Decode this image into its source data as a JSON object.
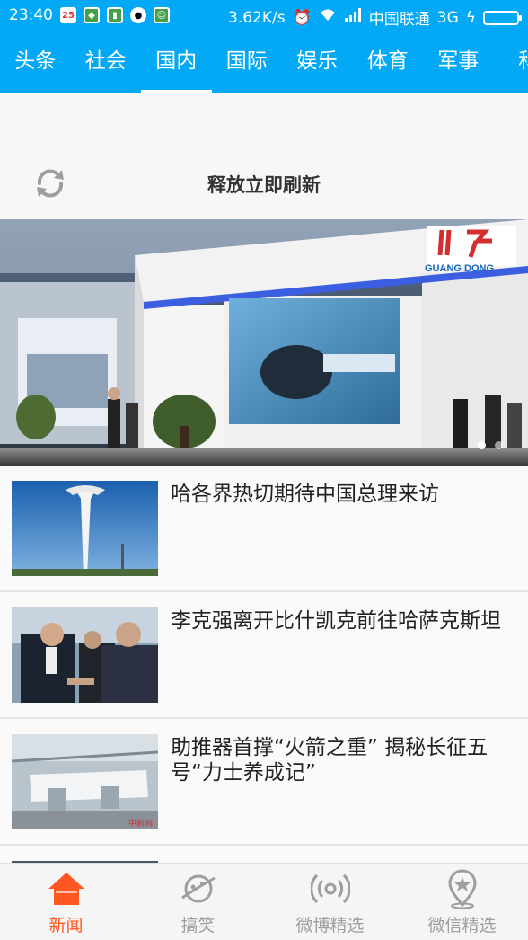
{
  "status_bar": {
    "time": "23:40",
    "calendar_day": "25",
    "speed": "3.62K/s",
    "carrier": "中国联通",
    "network": "3G"
  },
  "tabs": [
    {
      "label": "头条"
    },
    {
      "label": "社会"
    },
    {
      "label": "国内",
      "active": true
    },
    {
      "label": "国际"
    },
    {
      "label": "娱乐"
    },
    {
      "label": "体育"
    },
    {
      "label": "军事"
    },
    {
      "label": "科"
    }
  ],
  "refresh": {
    "label": "释放立即刷新",
    "icon": "refresh-icon"
  },
  "banner": {
    "sign_text": "GUANG DONG",
    "slides": 2,
    "active_slide": 1
  },
  "news": [
    {
      "title": "哈各界热切期待中国总理来访"
    },
    {
      "title": "李克强离开比什凯克前往哈萨克斯坦"
    },
    {
      "title": "助推器首撑“火箭之重” 揭秘长征五号“力士养成记”"
    }
  ],
  "bottom_nav": [
    {
      "label": "新闻",
      "icon": "home-icon",
      "active": true
    },
    {
      "label": "搞笑",
      "icon": "planet-icon"
    },
    {
      "label": "微博精选",
      "icon": "broadcast-icon"
    },
    {
      "label": "微信精选",
      "icon": "location-pin-icon"
    }
  ],
  "colors": {
    "header": "#03a9f4",
    "active_nav": "#ff5722"
  }
}
